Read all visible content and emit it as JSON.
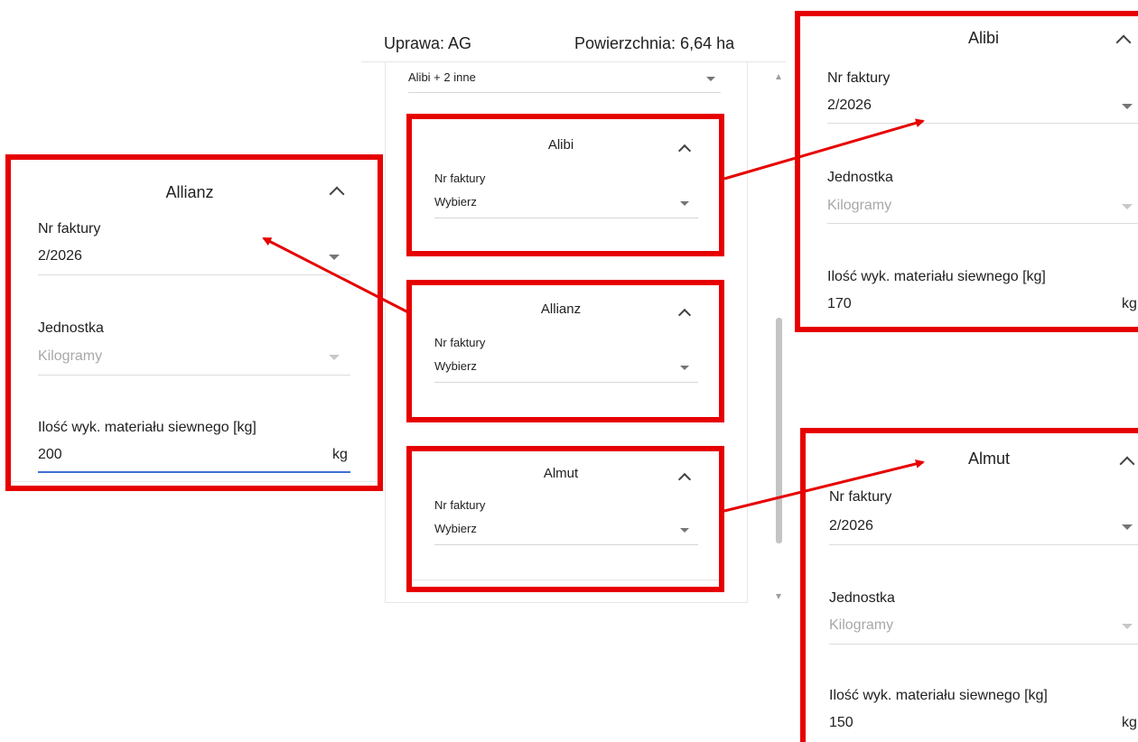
{
  "header": {
    "crop": "Uprawa: AG",
    "area": "Powierzchnia: 6,64 ha"
  },
  "variety_select": {
    "value": "Alibi + 2 inne"
  },
  "cards_small": [
    {
      "title": "Alibi",
      "invoice_label": "Nr faktury",
      "invoice_value": "Wybierz"
    },
    {
      "title": "Allianz",
      "invoice_label": "Nr faktury",
      "invoice_value": "Wybierz"
    },
    {
      "title": "Almut",
      "invoice_label": "Nr faktury",
      "invoice_value": "Wybierz"
    }
  ],
  "cards_zoomed": {
    "allianz": {
      "title": "Allianz",
      "invoice_label": "Nr faktury",
      "invoice_value": "2/2026",
      "unit_label": "Jednostka",
      "unit_value": "Kilogramy",
      "qty_label": "Ilość wyk. materiału siewnego [kg]",
      "qty_value": "200",
      "qty_suffix": "kg"
    },
    "alibi": {
      "title": "Alibi",
      "invoice_label": "Nr faktury",
      "invoice_value": "2/2026",
      "unit_label": "Jednostka",
      "unit_value": "Kilogramy",
      "qty_label": "Ilość wyk. materiału siewnego [kg]",
      "qty_value": "170",
      "qty_suffix": "kg"
    },
    "almut": {
      "title": "Almut",
      "invoice_label": "Nr faktury",
      "invoice_value": "2/2026",
      "unit_label": "Jednostka",
      "unit_value": "Kilogramy",
      "qty_label": "Ilość wyk. materiału siewnego [kg]",
      "qty_value": "150",
      "qty_suffix": "kg"
    }
  },
  "colors": {
    "annotation": "#e60000",
    "active_underline": "#3f6fd1"
  }
}
